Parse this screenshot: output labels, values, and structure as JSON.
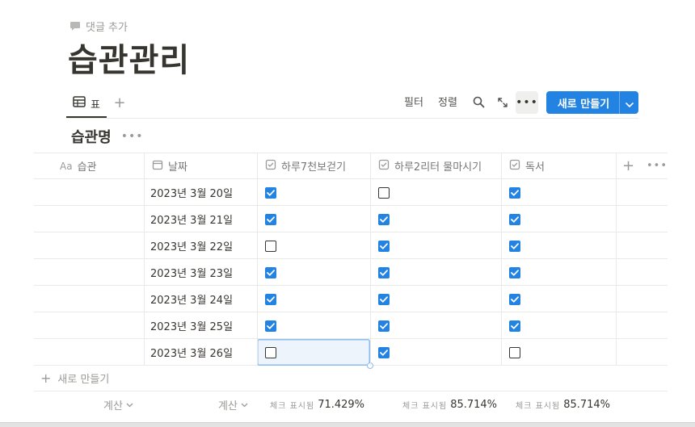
{
  "comment": {
    "label": "댓글 추가"
  },
  "page": {
    "title": "습관관리"
  },
  "toolbar": {
    "view_label": "표",
    "filter_label": "필터",
    "sort_label": "정렬",
    "new_label": "새로 만들기"
  },
  "group": {
    "title": "습관명"
  },
  "table": {
    "columns": [
      {
        "key": "habit",
        "label": "습관",
        "icon": "text-type-icon",
        "icon_text": "Aa"
      },
      {
        "key": "date",
        "label": "날짜",
        "icon": "calendar-icon"
      },
      {
        "key": "walk",
        "label": "하루7천보걷기",
        "icon": "checkbox-property-icon"
      },
      {
        "key": "water",
        "label": "하루2리터 물마시기",
        "icon": "checkbox-property-icon"
      },
      {
        "key": "reading",
        "label": "독서",
        "icon": "checkbox-property-icon"
      }
    ],
    "rows": [
      {
        "habit": "",
        "date": "2023년 3월 20일",
        "walk": true,
        "water": false,
        "reading": true
      },
      {
        "habit": "",
        "date": "2023년 3월 21일",
        "walk": true,
        "water": true,
        "reading": true
      },
      {
        "habit": "",
        "date": "2023년 3월 22일",
        "walk": false,
        "water": true,
        "reading": true
      },
      {
        "habit": "",
        "date": "2023년 3월 23일",
        "walk": true,
        "water": true,
        "reading": true
      },
      {
        "habit": "",
        "date": "2023년 3월 24일",
        "walk": true,
        "water": true,
        "reading": true
      },
      {
        "habit": "",
        "date": "2023년 3월 25일",
        "walk": true,
        "water": true,
        "reading": true
      },
      {
        "habit": "",
        "date": "2023년 3월 26일",
        "walk": false,
        "water": true,
        "reading": false
      }
    ],
    "new_row_label": "새로 만들기",
    "selected_row_index": 6,
    "selected_column": "walk"
  },
  "footer": {
    "calc_habit": "계산",
    "calc_date": "계산",
    "walk_key": "체크 표시됨",
    "walk_value": "71.429%",
    "water_key": "체크 표시됨",
    "water_value": "85.714%",
    "reading_key": "체크 표시됨",
    "reading_value": "85.714%"
  },
  "colors": {
    "accent": "#2383e2",
    "text": "#37352f",
    "muted": "#9b9a97",
    "border": "#e9e9e7"
  }
}
